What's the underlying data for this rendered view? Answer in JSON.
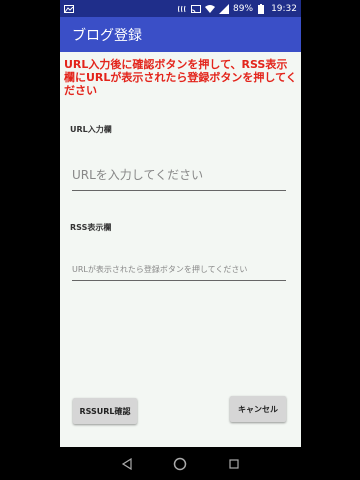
{
  "status_bar": {
    "battery": "89%",
    "time": "19:32"
  },
  "app_bar": {
    "title": "ブログ登録"
  },
  "main": {
    "instructions": "URL入力後に確認ボタンを押して、RSS表示欄にURLが表示されたら登録ボタンを押してください",
    "url_label": "URL入力欄",
    "url_placeholder": "URLを入力してください",
    "rss_label": "RSS表示欄",
    "rss_placeholder": "URLが表示されたら登録ボタンを押してください",
    "confirm_button": "RSSURL確認",
    "cancel_button": "キャンセル"
  },
  "icons": [
    "image-icon",
    "nfc-icon",
    "cast-icon",
    "wifi-icon",
    "signal-icon",
    "battery-icon",
    "back-icon",
    "home-icon",
    "recents-icon"
  ]
}
